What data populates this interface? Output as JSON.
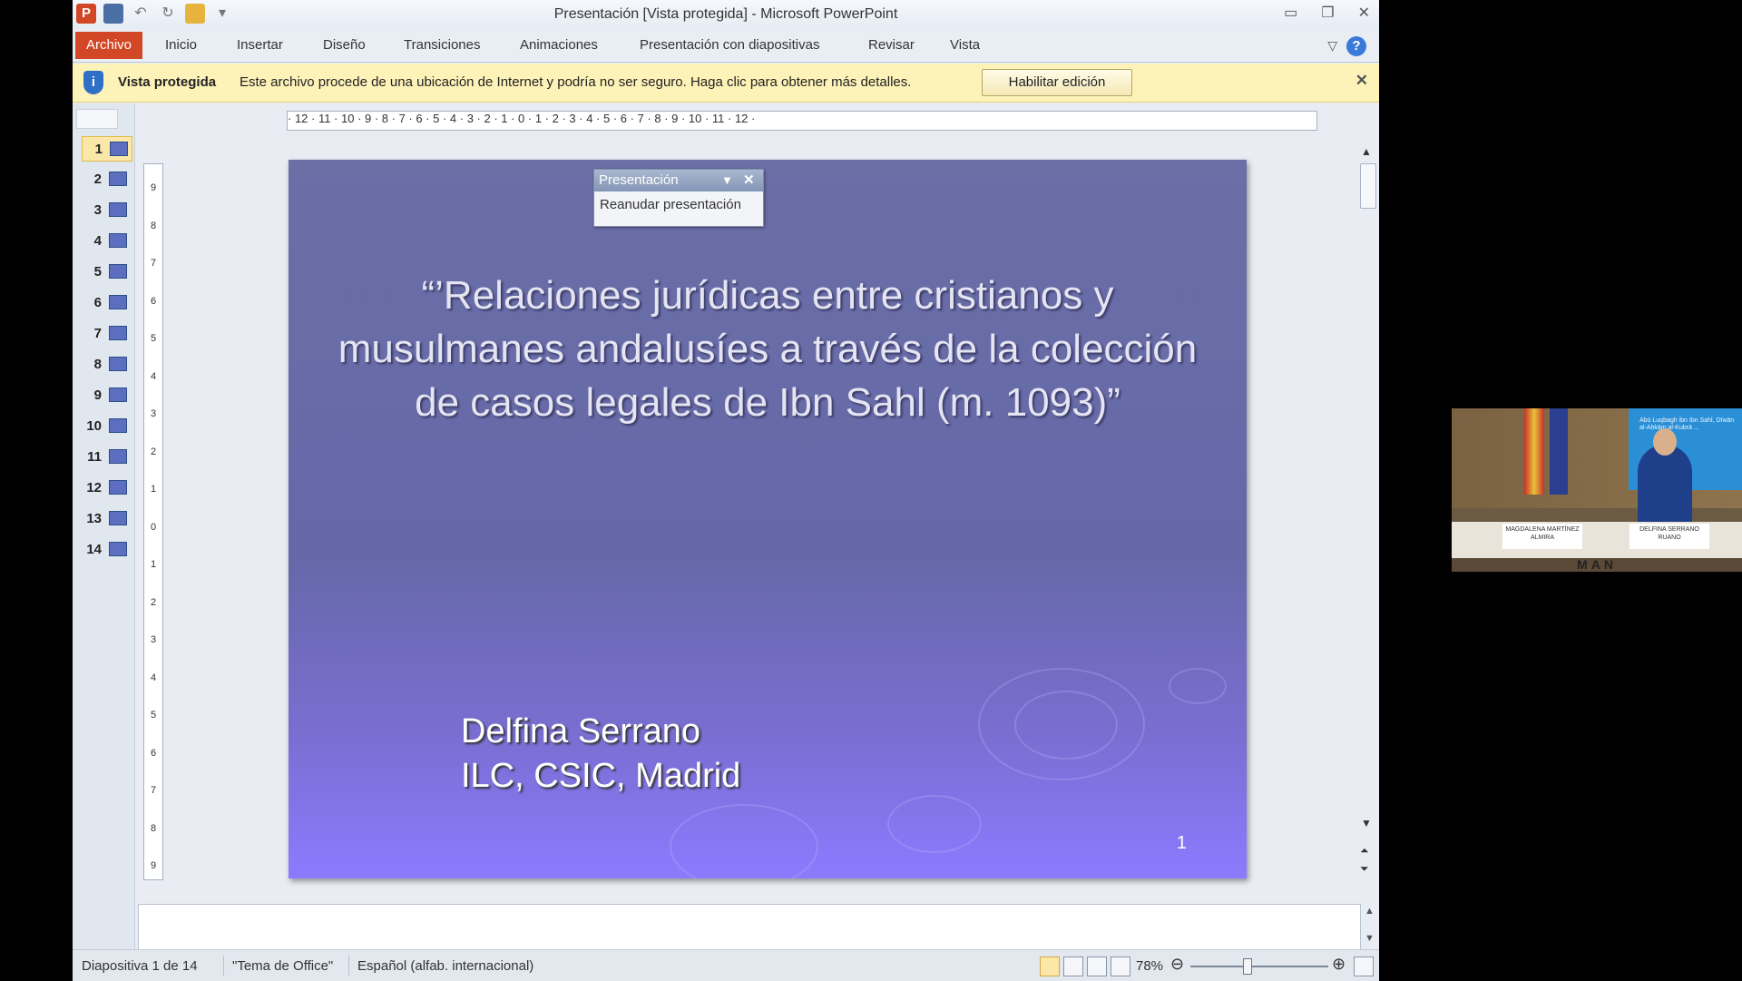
{
  "window": {
    "title": "Presentación [Vista protegida] - Microsoft PowerPoint"
  },
  "ribbon": {
    "tabs": [
      "Archivo",
      "Inicio",
      "Insertar",
      "Diseño",
      "Transiciones",
      "Animaciones",
      "Presentación con diapositivas",
      "Revisar",
      "Vista"
    ]
  },
  "protected_view": {
    "label": "Vista protegida",
    "message": "Este archivo procede de una ubicación de Internet y podría no ser seguro. Haga clic para obtener más detalles.",
    "button": "Habilitar edición"
  },
  "thumbnails": [
    "1",
    "2",
    "3",
    "4",
    "5",
    "6",
    "7",
    "8",
    "9",
    "10",
    "11",
    "12",
    "13",
    "14"
  ],
  "ruler": {
    "horizontal": "· 12 · 11 · 10 · 9 · 8 · 7 · 6 · 5 · 4 · 3 · 2 · 1 · 0 · 1 · 2 · 3 · 4 · 5 · 6 · 7 · 8 · 9 · 10 · 11 · 12 ·",
    "vertical": [
      "9",
      "8",
      "7",
      "6",
      "5",
      "4",
      "3",
      "2",
      "1",
      "0",
      "1",
      "2",
      "3",
      "4",
      "5",
      "6",
      "7",
      "8",
      "9"
    ]
  },
  "floating_toolbar": {
    "title": "Presentación",
    "item": "Reanudar presentación"
  },
  "slide": {
    "title": "“’Relaciones jurídicas entre cristianos y musulmanes andalusíes a través de la colección de casos legales de Ibn Sahl (m. 1093)”",
    "author_line1": "Delfina Serrano",
    "author_line2": "ILC, CSIC, Madrid",
    "number": "1"
  },
  "status": {
    "slide_info": "Diapositiva 1 de 14",
    "theme": "\"Tema de Office\"",
    "language": "Español (alfab. internacional)",
    "zoom": "78%"
  },
  "webcam": {
    "screen_text": "Abū Luqbagh ibn Ibn Sahl, Dīwān al-Aḥkām al-Kubrā ...",
    "plate_left": "MAGDALENA MARTÍNEZ ALMIRA",
    "plate_right": "DELFINA SERRANO RUANO",
    "banner": "MAN"
  },
  "colors": {
    "accent_file": "#d24726",
    "protected_bar": "#fdf2b8",
    "slide_top": "#6a6fa6",
    "slide_bottom": "#8d7aff"
  }
}
